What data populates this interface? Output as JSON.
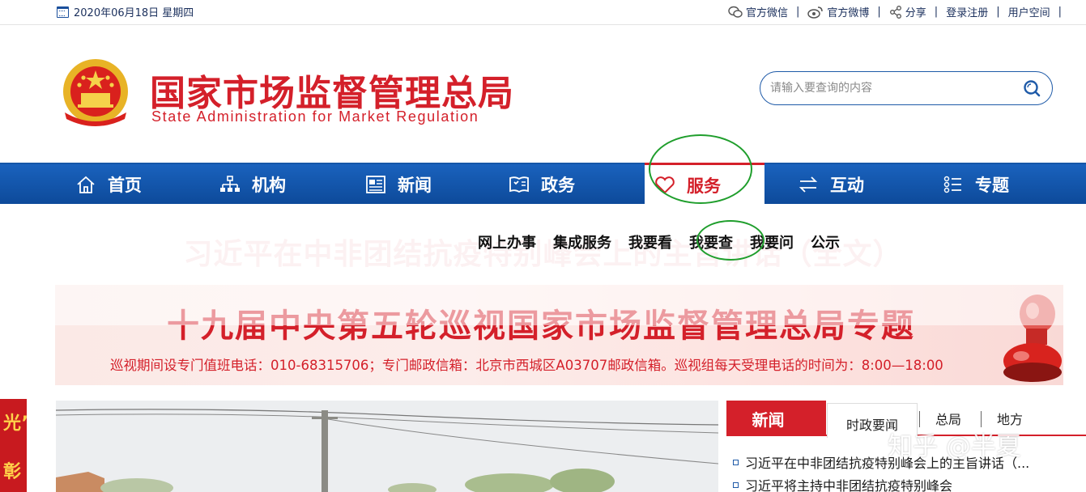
{
  "topbar": {
    "date": "2020年06月18日 星期四",
    "links": [
      {
        "label": "官方微信",
        "icon": "wechat-icon"
      },
      {
        "label": "官方微博",
        "icon": "weibo-icon"
      },
      {
        "label": "分享",
        "icon": "share-icon"
      },
      {
        "label": "登录注册"
      },
      {
        "label": "用户空间"
      }
    ],
    "separator": "|"
  },
  "header": {
    "logo_cn": "国家市场监督管理总局",
    "logo_en": "State Administration for Market Regulation",
    "search_placeholder": "请输入要查询的内容"
  },
  "nav": {
    "items": [
      {
        "label": "首页",
        "icon": "home-icon"
      },
      {
        "label": "机构",
        "icon": "org-chart-icon"
      },
      {
        "label": "新闻",
        "icon": "newspaper-icon"
      },
      {
        "label": "政务",
        "icon": "shield-book-icon"
      },
      {
        "label": "服务",
        "icon": "heart-icon",
        "active": true
      },
      {
        "label": "互动",
        "icon": "exchange-icon"
      },
      {
        "label": "专题",
        "icon": "list-icon"
      }
    ]
  },
  "subnav": {
    "items": [
      "网上办事",
      "集成服务",
      "我要看",
      "我要查",
      "我要问",
      "公示"
    ]
  },
  "headline_faded": "习近平在中非团结抗疫特别峰会上的主旨讲话（全文）",
  "banner": {
    "title": "十九届中央第五轮巡视国家市场监督管理总局专题",
    "subtitle": "巡视期间设专门值班电话：010-68315706；专门邮政信箱：北京市西城区A03707邮政信箱。巡视组每天受理电话的时间为：8:00—18:00"
  },
  "left_strip": {
    "chars": [
      "光”",
      "彰"
    ]
  },
  "news": {
    "head": "新闻",
    "tabs": [
      "时政要闻",
      "总局",
      "地方"
    ],
    "items": [
      "习近平在中非团结抗疫特别峰会上的主旨讲话（...",
      "习近平将主持中非团结抗疫特别峰会"
    ]
  },
  "watermark": "知乎 @半夏",
  "colors": {
    "brand_red": "#d4202a",
    "nav_blue": "#0d4a9a",
    "annotation_green": "#1f9e2c"
  }
}
